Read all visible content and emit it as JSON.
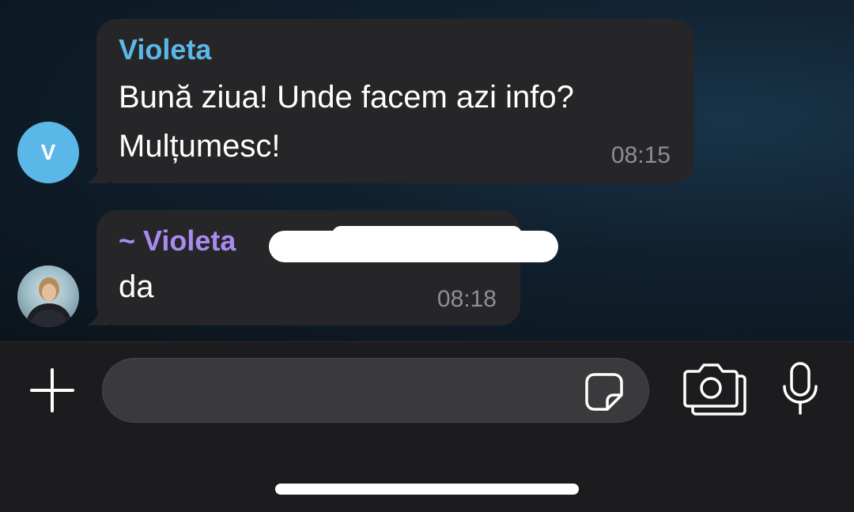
{
  "messages": [
    {
      "avatar": "V",
      "avatar_color": "#5ab7e8",
      "sender": "Violeta",
      "sender_color": "#5ab7e8",
      "lines": [
        "Bună ziua! Unde facem azi info?",
        "Mulțumesc!"
      ],
      "time": "08:15"
    },
    {
      "avatar_icon": "user-photo",
      "sender": "~ Violeta",
      "sender_color": "#a98af0",
      "lines": [
        "da"
      ],
      "time": "08:18"
    }
  ],
  "composer": {
    "placeholder": "",
    "icons": [
      "plus-icon",
      "sticker-icon",
      "camera-icon",
      "microphone-icon"
    ]
  },
  "colors": {
    "bubble": "#262628",
    "background": "#0b141c",
    "input_bar": "#1c1c1e",
    "timestamp": "#8e8e93"
  }
}
